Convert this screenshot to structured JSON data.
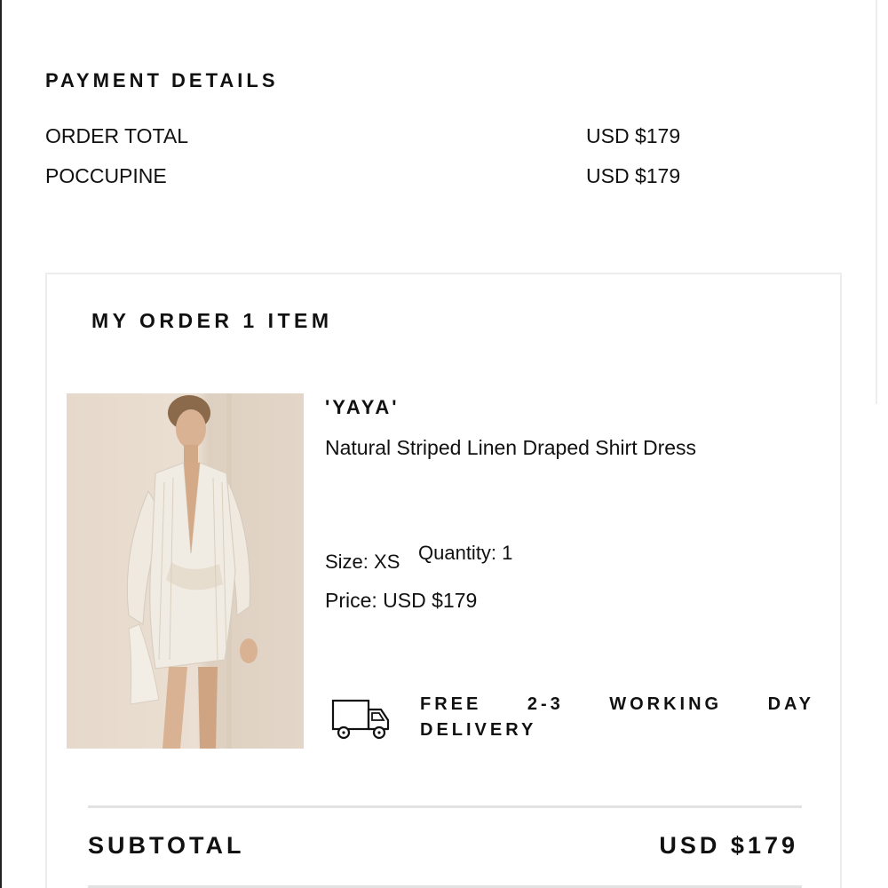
{
  "payment": {
    "title": "PAYMENT DETAILS",
    "rows": [
      {
        "label": "ORDER TOTAL",
        "value": "USD $179"
      },
      {
        "label": "POCCUPINE",
        "value": "USD $179"
      }
    ]
  },
  "order": {
    "title": "MY ORDER 1 ITEM",
    "item": {
      "brand": "'YAYA'",
      "name": "Natural Striped Linen Draped Shirt Dress",
      "size": "Size: XS",
      "quantity": "Quantity: 1",
      "price": "Price: USD $179",
      "image_icon": "product-photo-dress",
      "delivery_icon": "delivery-truck-icon",
      "delivery_line1": "FREE 2-3 WORKING DAY",
      "delivery_line2": "DELIVERY"
    },
    "subtotal": {
      "label": "SUBTOTAL",
      "value": "USD $179"
    }
  },
  "colors": {
    "text": "#111111",
    "border": "#ececec",
    "divider": "#e2e2e2",
    "image_background": "#e6d9cb"
  }
}
